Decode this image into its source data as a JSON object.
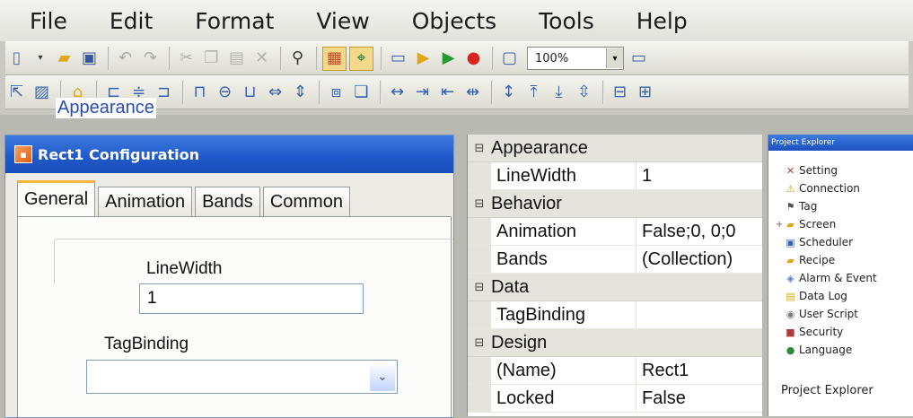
{
  "menu": [
    "File",
    "Edit",
    "Format",
    "View",
    "Objects",
    "Tools",
    "Help"
  ],
  "toolbar": {
    "zoom": "100%"
  },
  "dialog": {
    "title": "Rect1 Configuration",
    "tabs": [
      "General",
      "Animation",
      "Bands",
      "Common"
    ],
    "group_label": "Appearance",
    "linewidth_label": "LineWidth",
    "linewidth_value": "1",
    "tagbinding_label": "TagBinding",
    "tagbinding_value": ""
  },
  "properties": {
    "categories": [
      {
        "name": "Appearance",
        "rows": [
          {
            "name": "LineWidth",
            "value": "1"
          }
        ]
      },
      {
        "name": "Behavior",
        "rows": [
          {
            "name": "Animation",
            "value": "False;0, 0;0"
          },
          {
            "name": "Bands",
            "value": "(Collection)"
          }
        ]
      },
      {
        "name": "Data",
        "rows": [
          {
            "name": "TagBinding",
            "value": ""
          }
        ]
      },
      {
        "name": "Design",
        "rows": [
          {
            "name": "(Name)",
            "value": "Rect1"
          },
          {
            "name": "Locked",
            "value": "False"
          }
        ]
      }
    ]
  },
  "explorer": {
    "title": "Project Explorer",
    "items": [
      {
        "label": "Setting",
        "icon": "wrench-icon"
      },
      {
        "label": "Connection",
        "icon": "connection-icon"
      },
      {
        "label": "Tag",
        "icon": "tag-icon"
      },
      {
        "label": "Screen",
        "icon": "folder-icon"
      },
      {
        "label": "Scheduler",
        "icon": "scheduler-icon"
      },
      {
        "label": "Recipe",
        "icon": "folder-icon"
      },
      {
        "label": "Alarm & Event",
        "icon": "alarm-icon"
      },
      {
        "label": "Data Log",
        "icon": "datalog-icon"
      },
      {
        "label": "User Script",
        "icon": "script-icon"
      },
      {
        "label": "Security",
        "icon": "security-icon"
      },
      {
        "label": "Language",
        "icon": "language-icon"
      }
    ],
    "footer": "Project Explorer"
  }
}
